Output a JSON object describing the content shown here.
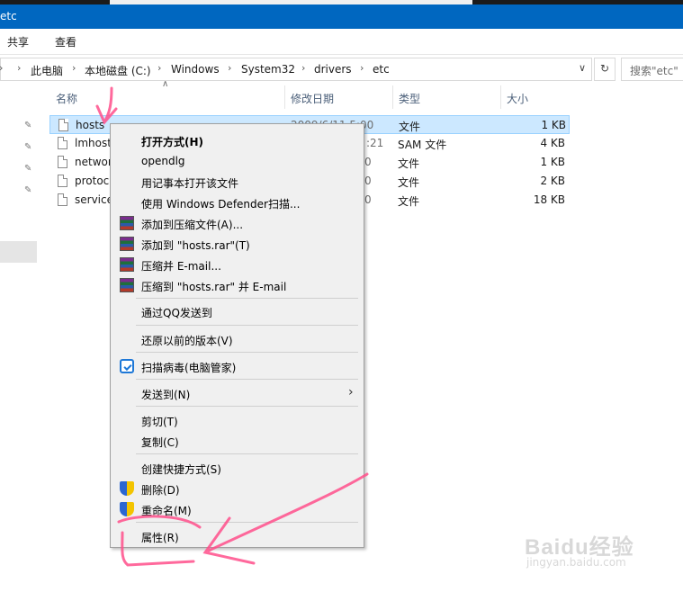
{
  "window": {
    "title": "etc"
  },
  "ribbon": {
    "tabs": [
      "共享",
      "查看"
    ]
  },
  "address": {
    "crumbs": [
      "此电脑",
      "本地磁盘 (C:)",
      "Windows",
      "System32",
      "drivers",
      "etc"
    ],
    "search_placeholder": "搜索\"etc\""
  },
  "columns": {
    "name": "名称",
    "date": "修改日期",
    "type": "类型",
    "size": "大小"
  },
  "files": [
    {
      "name": "hosts",
      "date": "2009/6/11 5:00",
      "type": "文件",
      "size": "1 KB",
      "selected": true
    },
    {
      "name": "lmhost",
      "date": ":21",
      "type": "SAM 文件",
      "size": "4 KB"
    },
    {
      "name": "networ",
      "date": "0",
      "type": "文件",
      "size": "1 KB"
    },
    {
      "name": "protoc",
      "date": "0",
      "type": "文件",
      "size": "2 KB"
    },
    {
      "name": "service",
      "date": "0",
      "type": "文件",
      "size": "18 KB"
    }
  ],
  "context_menu": {
    "items": [
      {
        "label": "打开方式(H)",
        "icon": "",
        "bold": true
      },
      {
        "label": "opendlg",
        "icon": ""
      },
      {
        "label": "用记事本打开该文件",
        "icon": ""
      },
      {
        "label": "使用 Windows Defender扫描...",
        "icon": ""
      },
      {
        "label": "添加到压缩文件(A)...",
        "icon": "winrar-icon"
      },
      {
        "label": "添加到 \"hosts.rar\"(T)",
        "icon": "winrar-icon"
      },
      {
        "label": "压缩并 E-mail...",
        "icon": "winrar-icon"
      },
      {
        "label": "压缩到 \"hosts.rar\" 并 E-mail",
        "icon": "winrar-icon"
      },
      {
        "label": "通过QQ发送到",
        "icon": ""
      },
      {
        "label": "还原以前的版本(V)",
        "icon": ""
      },
      {
        "label": "扫描病毒(电脑管家)",
        "icon": "tencent-shield-icon"
      },
      {
        "label": "发送到(N)",
        "icon": "",
        "submenu": true
      },
      {
        "label": "剪切(T)",
        "icon": ""
      },
      {
        "label": "复制(C)",
        "icon": ""
      },
      {
        "label": "创建快捷方式(S)",
        "icon": ""
      },
      {
        "label": "删除(D)",
        "icon": "uac-shield-icon"
      },
      {
        "label": "重命名(M)",
        "icon": "uac-shield-icon"
      },
      {
        "label": "属性(R)",
        "icon": ""
      }
    ]
  },
  "watermark": {
    "line1": "Baidu经验",
    "line2": "jingyan.baidu.com"
  },
  "colors": {
    "titlebar": "#0067c0",
    "selection": "#cce8ff",
    "annotation": "#ff4f8b"
  }
}
